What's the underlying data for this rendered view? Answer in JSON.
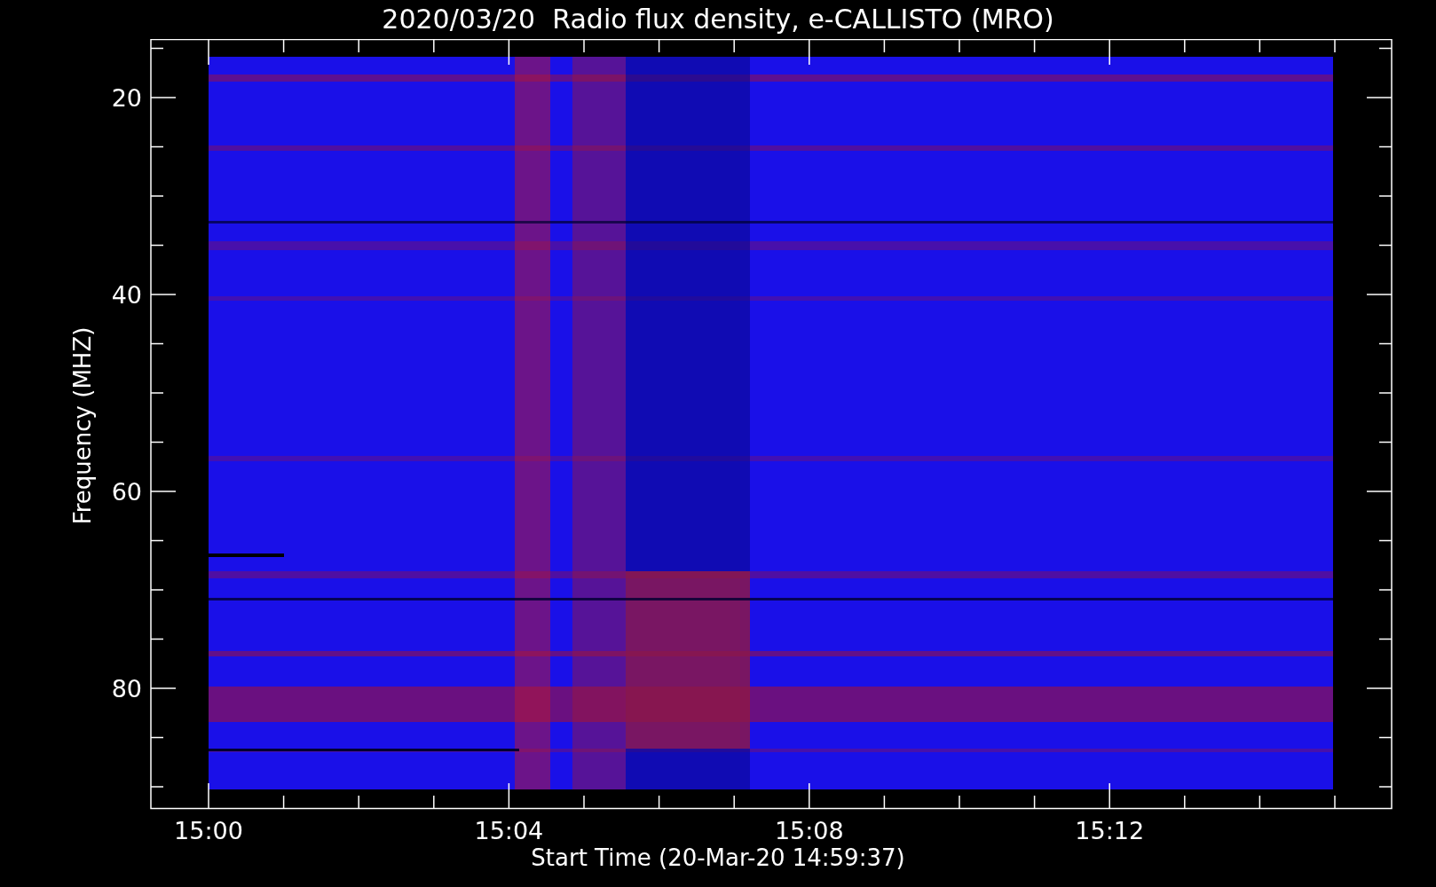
{
  "title": "2020/03/20  Radio flux density, e-CALLISTO (MRO)",
  "y_axis": {
    "label": "Frequency (MHZ)",
    "ticks": [
      "20",
      "40",
      "60",
      "80"
    ]
  },
  "x_axis": {
    "label": "Start Time (20-Mar-20 14:59:37)",
    "ticks": [
      "15:00",
      "15:04",
      "15:08",
      "15:12"
    ]
  }
}
